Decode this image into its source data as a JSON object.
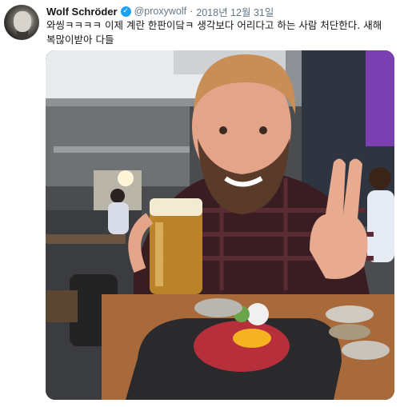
{
  "tweet": {
    "display_name": "Wolf Schröder",
    "verified_icon": "verified-check-icon",
    "handle": "@proxywolf",
    "separator": "·",
    "date": "2018년 12월 31일",
    "text": "와씽ㅋㅋㅋㅋ 이제 계란 한판이닼ㅋ 생각보다 어리다고 하는 사람 처단한다. 새해 복많이받아 다들"
  },
  "colors": {
    "verified": "#1da1f2",
    "muted_text": "#657786",
    "body_text": "#14171a"
  }
}
